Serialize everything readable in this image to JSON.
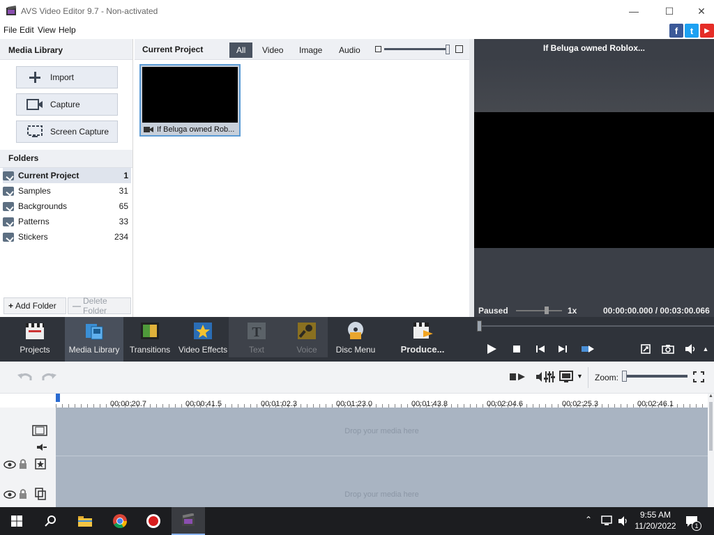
{
  "window": {
    "title": "AVS Video Editor 9.7 - Non-activated",
    "minimize": "—",
    "maximize": "☐",
    "close": "✕"
  },
  "menu": [
    "File",
    "Edit",
    "View",
    "Help"
  ],
  "social": {
    "facebook": "f",
    "twitter": "t",
    "youtube": "▶"
  },
  "media_library": {
    "header": "Media Library",
    "buttons": [
      "Import",
      "Capture",
      "Screen Capture"
    ],
    "folders_header": "Folders",
    "folders": [
      {
        "name": "Current Project",
        "count": "1"
      },
      {
        "name": "Samples",
        "count": "31"
      },
      {
        "name": "Backgrounds",
        "count": "65"
      },
      {
        "name": "Patterns",
        "count": "33"
      },
      {
        "name": "Stickers",
        "count": "234"
      }
    ],
    "add_folder": "Add Folder",
    "delete_folder": "Delete Folder"
  },
  "project": {
    "header": "Current Project",
    "tabs": [
      "All",
      "Video",
      "Image",
      "Audio"
    ],
    "active_tab": "All",
    "item_caption": "If Beluga owned Rob..."
  },
  "preview": {
    "title": "If Beluga owned Roblox...",
    "status": "Paused",
    "speed": "1x",
    "time": "00:00:00.000 / 00:03:00.066"
  },
  "tools": [
    {
      "label": "Projects",
      "icon": "clapper-icon"
    },
    {
      "label": "Media Library",
      "icon": "media-library-icon"
    },
    {
      "label": "Transitions",
      "icon": "transitions-icon"
    },
    {
      "label": "Video Effects",
      "icon": "star-icon"
    },
    {
      "label": "Text",
      "icon": "text-icon"
    },
    {
      "label": "Voice",
      "icon": "microphone-icon"
    },
    {
      "label": "Disc Menu",
      "icon": "disc-icon"
    },
    {
      "label": "Produce...",
      "icon": "produce-icon"
    }
  ],
  "timeline": {
    "zoom_label": "Zoom:",
    "ticks": [
      "00:00:20.7",
      "00:00:41.5",
      "00:01:02.3",
      "00:01:23.0",
      "00:01:43.8",
      "00:02:04.6",
      "00:02:25.3",
      "00:02:46.1"
    ],
    "drop_text": "Drop your media here"
  },
  "taskbar": {
    "time": "9:55 AM",
    "date": "11/20/2022",
    "notifications": "1"
  }
}
